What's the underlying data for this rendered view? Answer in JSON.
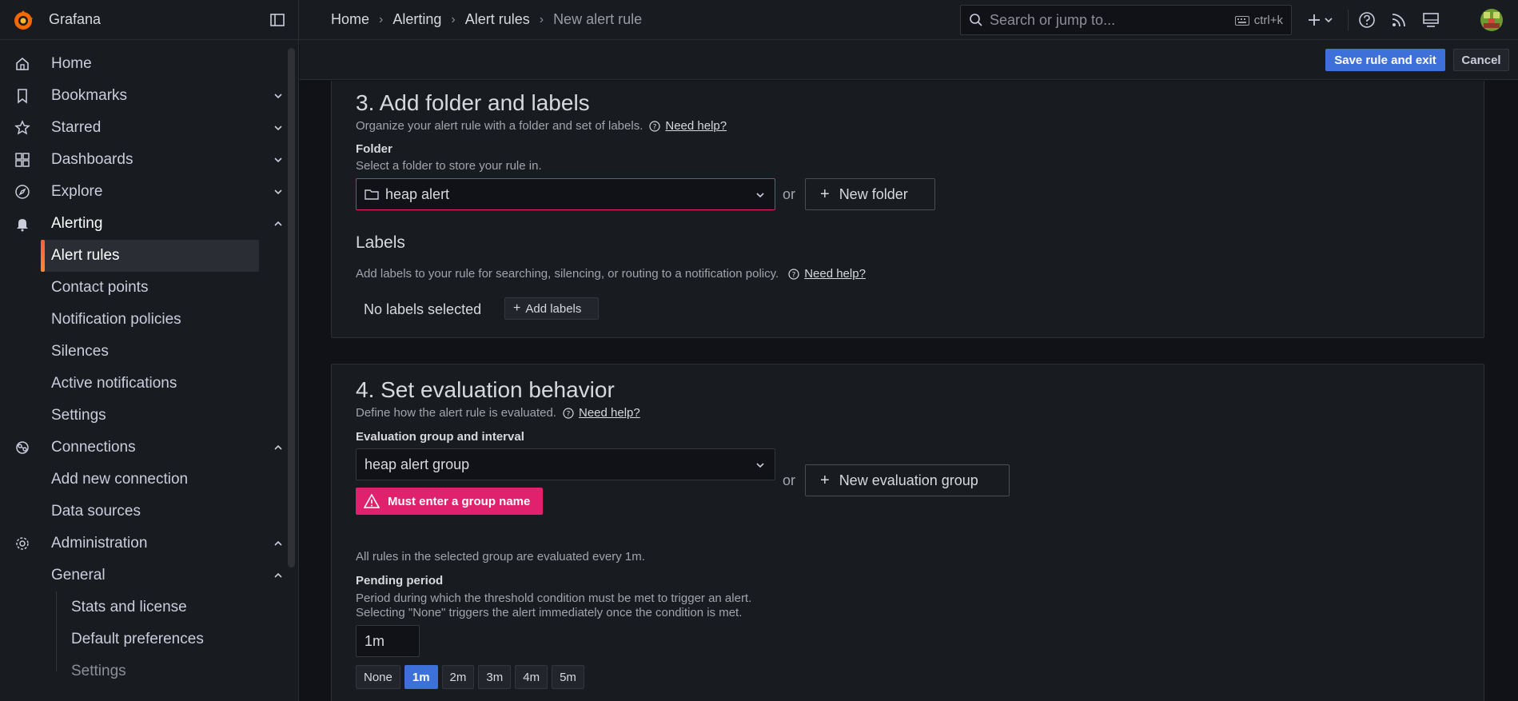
{
  "app": {
    "brand": "Grafana"
  },
  "breadcrumb": [
    {
      "label": "Home"
    },
    {
      "label": "Alerting"
    },
    {
      "label": "Alert rules"
    },
    {
      "label": "New alert rule"
    }
  ],
  "search": {
    "placeholder": "Search or jump to...",
    "shortcut": "ctrl+k"
  },
  "sidebar": {
    "items": [
      {
        "label": "Home",
        "icon": "home-icon"
      },
      {
        "label": "Bookmarks",
        "icon": "bookmark-icon"
      },
      {
        "label": "Starred",
        "icon": "star-icon"
      },
      {
        "label": "Dashboards",
        "icon": "dashboards-icon"
      },
      {
        "label": "Explore",
        "icon": "compass-icon"
      },
      {
        "label": "Alerting",
        "icon": "bell-icon"
      },
      {
        "label": "Connections",
        "icon": "connections-icon"
      },
      {
        "label": "Administration",
        "icon": "gear-icon"
      }
    ],
    "alerting_sub": [
      "Alert rules",
      "Contact points",
      "Notification policies",
      "Silences",
      "Active notifications",
      "Settings"
    ],
    "connections_sub": [
      "Add new connection",
      "Data sources"
    ],
    "admin_sub": [
      "General"
    ],
    "general_sub": [
      "Stats and license",
      "Default preferences",
      "Settings"
    ]
  },
  "actions": {
    "save": "Save rule and exit",
    "cancel": "Cancel"
  },
  "section3": {
    "title": "3. Add folder and labels",
    "desc": "Organize your alert rule with a folder and set of labels.",
    "help": "Need help?",
    "folder_label": "Folder",
    "folder_desc": "Select a folder to store your rule in.",
    "folder_value": "heap alert",
    "or": "or",
    "new_folder": "New folder",
    "labels_title": "Labels",
    "labels_desc": "Add labels to your rule for searching, silencing, or routing to a notification policy.",
    "labels_help": "Need help?",
    "no_labels": "No labels selected",
    "add_labels": "Add labels"
  },
  "section4": {
    "title": "4. Set evaluation behavior",
    "desc": "Define how the alert rule is evaluated.",
    "help": "Need help?",
    "group_label": "Evaluation group and interval",
    "group_value": "heap alert group",
    "or": "or",
    "new_group": "New evaluation group",
    "error": "Must enter a group name",
    "interval_note": "All rules in the selected group are evaluated every 1m.",
    "pending_label": "Pending period",
    "pending_desc1": "Period during which the threshold condition must be met to trigger an alert.",
    "pending_desc2": "Selecting \"None\" triggers the alert immediately once the condition is met.",
    "pending_value": "1m",
    "pending_options": [
      "None",
      "1m",
      "2m",
      "3m",
      "4m",
      "5m"
    ],
    "pending_selected": "1m"
  },
  "colors": {
    "primary": "#3d71d9",
    "error": "#e0226e",
    "accent": "#ff8833"
  }
}
